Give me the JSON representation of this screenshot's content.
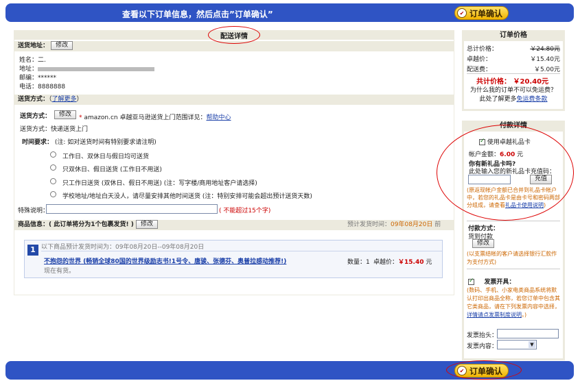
{
  "top": {
    "message": "查看以下订单信息，然后点击”订单确认”",
    "confirm": "订单确认"
  },
  "delivery_title": "配送详情",
  "address": {
    "label": "送货地址：",
    "edit": "修改",
    "name_label": "姓名：",
    "name": "二.",
    "addr_label": "地址：",
    "zip_label": "邮编：",
    "zip": "******",
    "phone_label": "电话：",
    "phone": "8888888"
  },
  "shipping": {
    "label": "送货方式：",
    "more": "了解更多",
    "more_paren_open": "（",
    "more_paren_close": "）",
    "method_label": "送货方式：",
    "edit": "修改",
    "note": "amazon.cn 卓越亚马逊送货上门范围详见：",
    "help": "帮助中心",
    "method": "送货方式：快递送货上门",
    "time_label": "时间要求：",
    "time_note": "(注: 如对送货时间有特别要求请注明)",
    "options": [
      "工作日、双休日与假日均可送货",
      "只双休日、假日送货 (工作日不用送)",
      "只工作日送货 (双休日、假日不用送) (注：写字楼/商用地址客户请选择)",
      "学校地址/地址白天没人，请尽量安排其他时间送货 (注：特别安排可能会超出预计送货天数)"
    ],
    "special_label": "特殊说明：",
    "special_hint": "( 不能超过15个字)"
  },
  "goods": {
    "label": "商品信息：",
    "note": "( 此订单将分为1个包裹发货! )",
    "edit": "修改",
    "eta_label": "预计发货时间：",
    "eta_date": "09年08月20日",
    "eta_suffix": "前",
    "package_no": "1",
    "package_eta": "以下商品预计发货时间为：09年08月20日--09年08月20日",
    "item_title": "不抱怨的世界 (畅销全球80国的世界级励志书!1号令、唐骏、张德芬、奥普拉感动推荐!)",
    "stock": "现在有货。",
    "qty": "数量：1",
    "price_label": "卓越价：",
    "price": "￥15.40",
    "price_unit": "元"
  },
  "price_box": {
    "title": "订单价格",
    "rows": [
      {
        "label": "总计价格：",
        "value": "￥24.80元"
      },
      {
        "label": "卓越价：",
        "value": "￥15.40元"
      },
      {
        "label": "配送费：",
        "value": "￥5.00元"
      }
    ],
    "total_label": "共计价格：",
    "total": "￥20.40元",
    "freeship_q": "为什么我的订单不可以免运费？此处了解更多",
    "freeship_link": "免运费条款"
  },
  "payment": {
    "title": "付款详情",
    "use_gift": "使用卓越礼品卡",
    "balance_label": "帐户金额：",
    "balance": "6.00",
    "balance_unit": "元",
    "new_card_q": "你有新礼品卡吗?",
    "new_card_hint": "此处输入您的新礼品卡充值码：",
    "recharge": "充值",
    "gift_note": "(原返现帐户金额已合并到礼品卡帐户中，若您的礼品卡是由卡号和密码两部分组成，请查看",
    "gift_link": "礼品卡使用说明",
    "gift_note_end": ")",
    "pay_method_label": "付款方式：",
    "pay_method": "货到付款",
    "edit": "修改",
    "pay_note": "(以支票结帐的客户请选择银行汇款作为支付方式)",
    "invoice_label": "发票开具：",
    "invoice_note": "(数码、手机、小家电类商品系统将默认打印出商品全称，若您订单中包含其它类商品，请在下列发票内容中选择，",
    "invoice_link": "详情请点发票制度说明",
    "invoice_note_end": "。)",
    "invoice_title_label": "发票抬头：",
    "invoice_content_label": "发票内容："
  }
}
